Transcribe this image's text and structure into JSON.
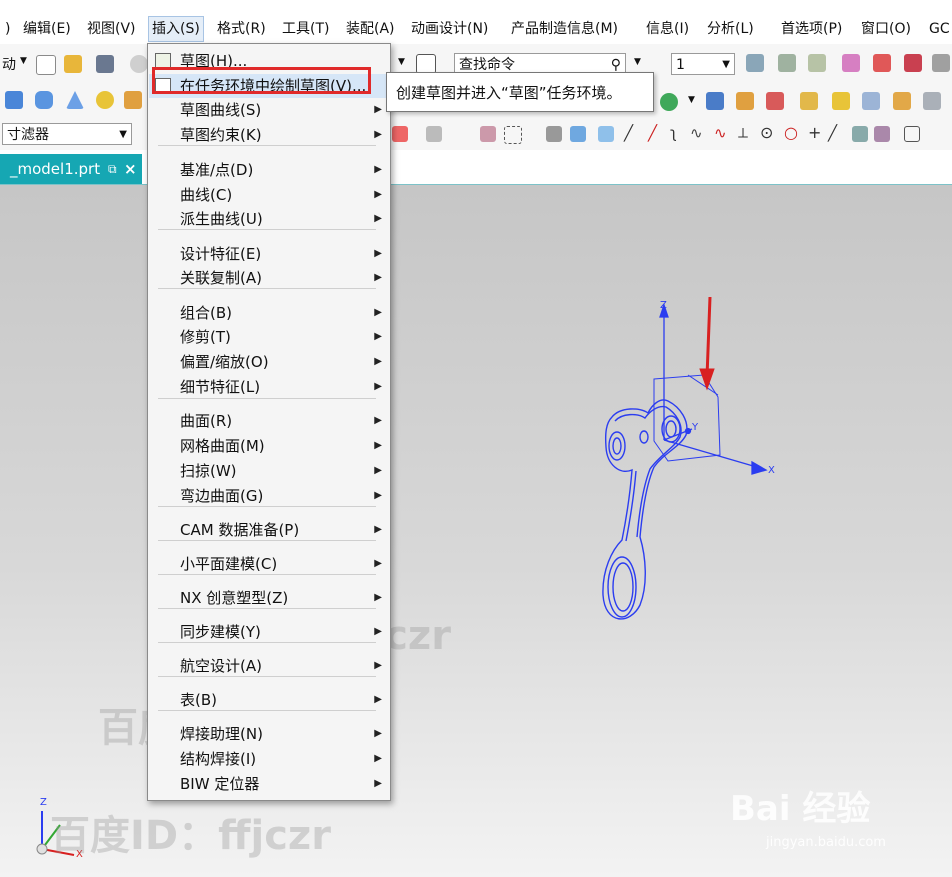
{
  "menubar": {
    "items": [
      {
        "label": ")"
      },
      {
        "label": "编辑(E)"
      },
      {
        "label": "视图(V)"
      },
      {
        "label": "插入(S)"
      },
      {
        "label": "格式(R)"
      },
      {
        "label": "工具(T)"
      },
      {
        "label": "装配(A)"
      },
      {
        "label": "动画设计(N)"
      },
      {
        "label": "产品制造信息(M)"
      },
      {
        "label": "信息(I)"
      },
      {
        "label": "分析(L)"
      },
      {
        "label": "首选项(P)"
      },
      {
        "label": "窗口(O)"
      },
      {
        "label": "GC"
      }
    ],
    "active_index": 3
  },
  "toolbar": {
    "left_label": "动",
    "search_placeholder": "查找命令",
    "layer_value": "1",
    "filter_value": "寸滤器"
  },
  "tab": {
    "label": "_model1.prt",
    "pin": "⧉",
    "close": "×"
  },
  "dropdown": {
    "items": [
      {
        "label": "草图(H)...",
        "submenu": false,
        "icon": "sketch-icon"
      },
      {
        "label": "在任务环境中绘制草图(V)...",
        "submenu": false,
        "icon": "sketch-task-icon",
        "highlighted": true
      },
      {
        "label": "草图曲线(S)",
        "submenu": true
      },
      {
        "label": "草图约束(K)",
        "submenu": true
      },
      {
        "label": "基准/点(D)",
        "submenu": true
      },
      {
        "label": "曲线(C)",
        "submenu": true
      },
      {
        "label": "派生曲线(U)",
        "submenu": true
      },
      {
        "label": "设计特征(E)",
        "submenu": true
      },
      {
        "label": "关联复制(A)",
        "submenu": true
      },
      {
        "label": "组合(B)",
        "submenu": true
      },
      {
        "label": "修剪(T)",
        "submenu": true
      },
      {
        "label": "偏置/缩放(O)",
        "submenu": true
      },
      {
        "label": "细节特征(L)",
        "submenu": true
      },
      {
        "label": "曲面(R)",
        "submenu": true
      },
      {
        "label": "网格曲面(M)",
        "submenu": true
      },
      {
        "label": "扫掠(W)",
        "submenu": true
      },
      {
        "label": "弯边曲面(G)",
        "submenu": true
      },
      {
        "label": "CAM 数据准备(P)",
        "submenu": true
      },
      {
        "label": "小平面建模(C)",
        "submenu": true
      },
      {
        "label": "NX 创意塑型(Z)",
        "submenu": true
      },
      {
        "label": "同步建模(Y)",
        "submenu": true
      },
      {
        "label": "航空设计(A)",
        "submenu": true
      },
      {
        "label": "表(B)",
        "submenu": true
      },
      {
        "label": "焊接助理(N)",
        "submenu": true
      },
      {
        "label": "结构焊接(I)",
        "submenu": true
      },
      {
        "label": "BIW 定位器",
        "submenu": true
      }
    ]
  },
  "tooltip": {
    "text": "创建草图并进入“草图”任务环境。"
  },
  "viewport": {
    "axes": {
      "z": "Z",
      "x": "X",
      "y": "Y"
    },
    "mini_axes": {
      "z": "Z",
      "x": "X"
    },
    "model_color": "#2b3df0",
    "arrow_color": "#d82020"
  },
  "watermarks": {
    "author": "百度ID：ffjczr",
    "brand": "Bai 经验",
    "url": "jingyan.baidu.com"
  }
}
